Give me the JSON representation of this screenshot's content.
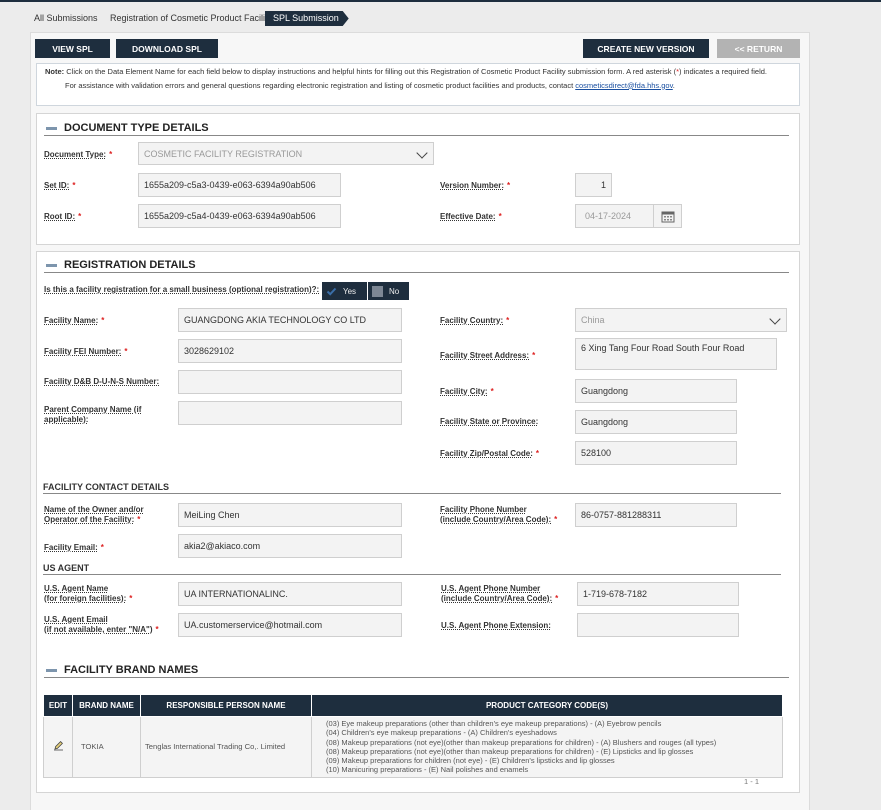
{
  "breadcrumbs": [
    "All Submissions",
    "Registration of Cosmetic Product Facility",
    "SPL Submission"
  ],
  "toolbar": {
    "view_spl": "VIEW SPL",
    "download_spl": "DOWNLOAD SPL",
    "create_new_version": "CREATE NEW VERSION",
    "return": "<< RETURN"
  },
  "note": {
    "label": "Note:",
    "line1": " Click on the Data Element Name for each field below to display instructions and helpful hints for filling out this Registration of Cosmetic Product Facility submission form. A red asterisk (",
    "asterisk": "*",
    "line1b": ") indicates a required field.",
    "line2": "For assistance with validation errors and general questions regarding electronic registration and listing of cosmetic product facilities and products, contact ",
    "email": "cosmeticsdirect@fda.hhs.gov",
    "line2end": "."
  },
  "document_type": {
    "title": "DOCUMENT TYPE DETAILS",
    "doc_type_label": "Document Type:",
    "doc_type_value": "COSMETIC FACILITY REGISTRATION",
    "set_id_label": "Set ID:",
    "set_id_value": "1655a209-c5a3-0439-e063-6394a90ab506",
    "root_id_label": "Root ID:",
    "root_id_value": "1655a209-c5a4-0439-e063-6394a90ab506",
    "version_label": "Version Number:",
    "version_value": "1",
    "effective_label": "Effective Date:",
    "effective_value": "04-17-2024"
  },
  "registration": {
    "title": "REGISTRATION DETAILS",
    "small_business_label": "Is this a facility registration for a small business (optional registration)?:",
    "yes": "Yes",
    "no": "No",
    "facility_name_label": "Facility Name:",
    "facility_name_value": "GUANGDONG AKIA TECHNOLOGY CO LTD",
    "fei_label": "Facility FEI Number:",
    "fei_value": "3028629102",
    "duns_label": "Facility D&B D-U-N-S Number:",
    "duns_value": "",
    "parent_label_1": "Parent Company Name (if",
    "parent_label_2": "applicable):",
    "parent_value": "",
    "country_label": "Facility Country:",
    "country_value": "China",
    "street_label": "Facility Street Address:",
    "street_value": "6 Xing Tang Four Road South Four Road",
    "city_label": "Facility City:",
    "city_value": "Guangdong",
    "state_label": "Facility State or Province:",
    "state_value": "Guangdong",
    "zip_label": "Facility Zip/Postal Code:",
    "zip_value": "528100"
  },
  "contact": {
    "title": "FACILITY CONTACT DETAILS",
    "owner_label_1": "Name of the Owner and/or",
    "owner_label_2": "Operator of the Facility:",
    "owner_value": "MeiLing Chen",
    "email_label": "Facility Email:",
    "email_value": "akia2@akiaco.com",
    "phone_label_1": "Facility Phone Number",
    "phone_label_2": "(include Country/Area Code):",
    "phone_value": "86-0757-881288311"
  },
  "us_agent": {
    "title": "US AGENT",
    "name_label_1": "U.S. Agent Name",
    "name_label_2": "(for foreign facilities):",
    "name_value": "UA INTERNATIONALINC.",
    "email_label_1": "U.S. Agent Email",
    "email_label_2": "(if not available, enter \"N/A\")",
    "email_value": "UA.customerservice@hotmail.com",
    "phone_label_1": "U.S. Agent Phone Number",
    "phone_label_2": "(include Country/Area Code):",
    "phone_value": "1-719-678-7182",
    "ext_label": "U.S. Agent Phone Extension:",
    "ext_value": ""
  },
  "brands": {
    "title": "FACILITY BRAND NAMES",
    "headers": [
      "EDIT",
      "BRAND NAME",
      "RESPONSIBLE PERSON NAME",
      "PRODUCT CATEGORY CODE(S)"
    ],
    "rows": [
      {
        "brand": "TOKIA",
        "responsible": "Tenglas International Trading Co,. Limited",
        "categories": [
          "(03) Eye makeup preparations (other than children's eye makeup preparations) - (A) Eyebrow pencils",
          "(04) Children's eye makeup preparations - (A) Children's eyeshadows",
          "(08) Makeup preparations (not eye)(other than makeup preparations for children) - (A) Blushers and rouges (all types)",
          "(08) Makeup preparations (not eye)(other than makeup preparations for children) - (E) Lipsticks and lip glosses",
          "(09) Makeup preparations for children (not eye) - (E) Children's lipsticks and lip glosses",
          "(10) Manicuring preparations - (E) Nail polishes and enamels"
        ]
      }
    ],
    "pager": "1 - 1"
  },
  "colors": {
    "navy": "#1e2e3e",
    "required": "#dd2222",
    "link": "#1a4fa0"
  }
}
